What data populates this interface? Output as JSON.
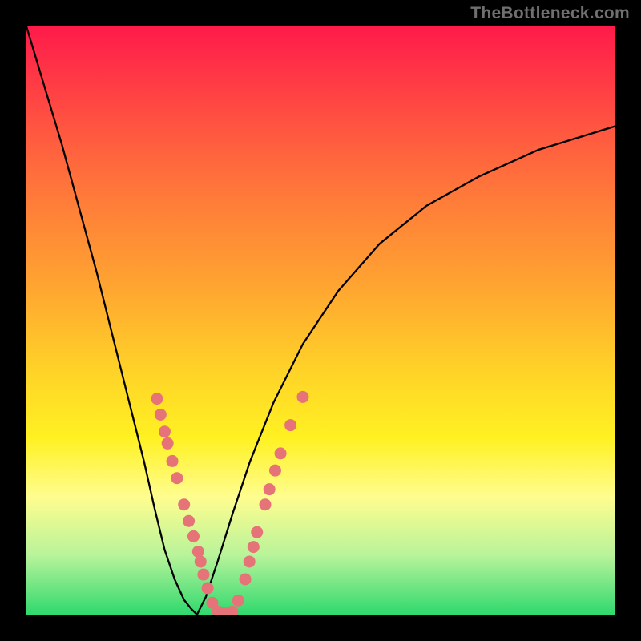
{
  "watermark": "TheBottleneck.com",
  "colors": {
    "curve": "#000000",
    "dot": "#e57378",
    "gradient_top": "#ff1a4a",
    "gradient_bottom": "#2fd96e",
    "frame": "#000000"
  },
  "chart_data": {
    "type": "line",
    "title": "",
    "xlabel": "",
    "ylabel": "",
    "xlim": [
      0,
      1
    ],
    "ylim": [
      0,
      1
    ],
    "series": [
      {
        "name": "left-branch",
        "x": [
          0.0,
          0.03,
          0.06,
          0.09,
          0.12,
          0.15,
          0.175,
          0.2,
          0.218,
          0.235,
          0.252,
          0.268,
          0.28,
          0.29
        ],
        "y": [
          1.0,
          0.9,
          0.8,
          0.69,
          0.58,
          0.46,
          0.36,
          0.26,
          0.18,
          0.11,
          0.06,
          0.025,
          0.01,
          0.0
        ]
      },
      {
        "name": "right-branch",
        "x": [
          0.29,
          0.305,
          0.325,
          0.35,
          0.38,
          0.42,
          0.47,
          0.53,
          0.6,
          0.68,
          0.77,
          0.87,
          1.0
        ],
        "y": [
          0.0,
          0.03,
          0.09,
          0.17,
          0.26,
          0.36,
          0.46,
          0.55,
          0.63,
          0.695,
          0.745,
          0.79,
          0.83
        ]
      }
    ],
    "points": [
      {
        "x": 0.222,
        "y": 0.367
      },
      {
        "x": 0.228,
        "y": 0.34
      },
      {
        "x": 0.235,
        "y": 0.311
      },
      {
        "x": 0.24,
        "y": 0.291
      },
      {
        "x": 0.248,
        "y": 0.261
      },
      {
        "x": 0.256,
        "y": 0.232
      },
      {
        "x": 0.268,
        "y": 0.187
      },
      {
        "x": 0.276,
        "y": 0.159
      },
      {
        "x": 0.284,
        "y": 0.133
      },
      {
        "x": 0.292,
        "y": 0.107
      },
      {
        "x": 0.296,
        "y": 0.09
      },
      {
        "x": 0.301,
        "y": 0.068
      },
      {
        "x": 0.308,
        "y": 0.045
      },
      {
        "x": 0.316,
        "y": 0.02
      },
      {
        "x": 0.326,
        "y": 0.005
      },
      {
        "x": 0.335,
        "y": 0.002
      },
      {
        "x": 0.343,
        "y": 0.002
      },
      {
        "x": 0.35,
        "y": 0.005
      },
      {
        "x": 0.36,
        "y": 0.024
      },
      {
        "x": 0.372,
        "y": 0.06
      },
      {
        "x": 0.379,
        "y": 0.09
      },
      {
        "x": 0.386,
        "y": 0.115
      },
      {
        "x": 0.392,
        "y": 0.14
      },
      {
        "x": 0.406,
        "y": 0.187
      },
      {
        "x": 0.413,
        "y": 0.213
      },
      {
        "x": 0.423,
        "y": 0.245
      },
      {
        "x": 0.432,
        "y": 0.274
      },
      {
        "x": 0.449,
        "y": 0.322
      },
      {
        "x": 0.47,
        "y": 0.37
      }
    ],
    "minimum_x": 0.29
  }
}
